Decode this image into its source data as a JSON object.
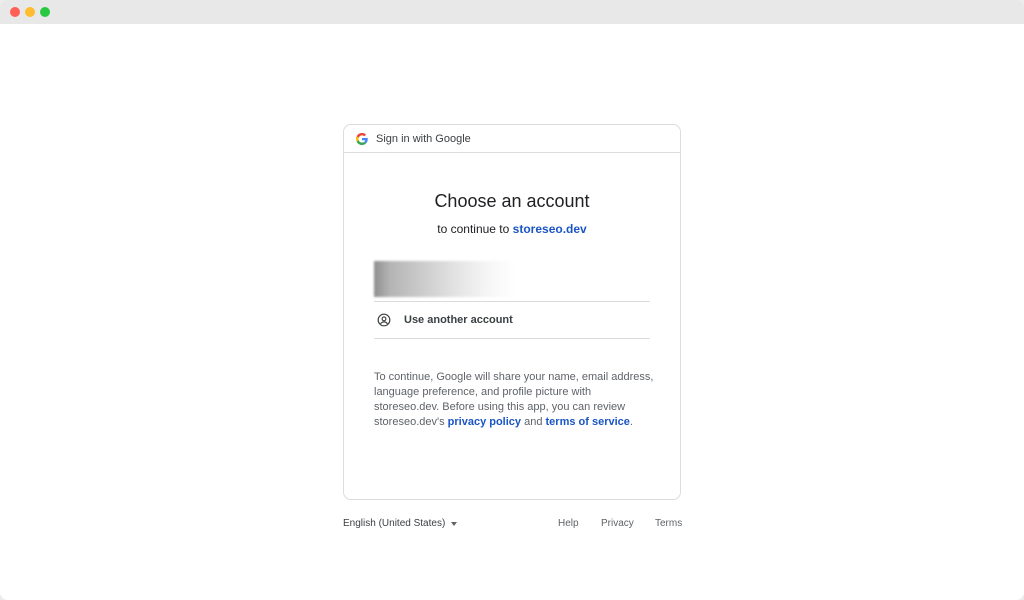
{
  "header": {
    "title": "Sign in with Google"
  },
  "main": {
    "title": "Choose an account",
    "subtitle_prefix": "to continue to",
    "app_domain": "storeseo.dev",
    "use_another_account": "Use another account",
    "disclosure_text": "To continue, Google will share your name, email address, language preference, and profile picture with storeseo.dev. Before using this app, you can review storeseo.dev's",
    "privacy_policy": "privacy policy",
    "and_text": "and",
    "terms_of_service": "terms of service",
    "period": "."
  },
  "footer": {
    "language": "English (United States)",
    "help": "Help",
    "privacy": "Privacy",
    "terms": "Terms"
  },
  "icons": {
    "header": "google-g-icon",
    "another_account": "account-circle-icon",
    "language_caret": "caret-down-icon"
  },
  "colors": {
    "link": "#1a55c4",
    "google_blue": "#4285F4",
    "google_red": "#EA4335",
    "google_yellow": "#FBBC05",
    "google_green": "#34A853"
  }
}
